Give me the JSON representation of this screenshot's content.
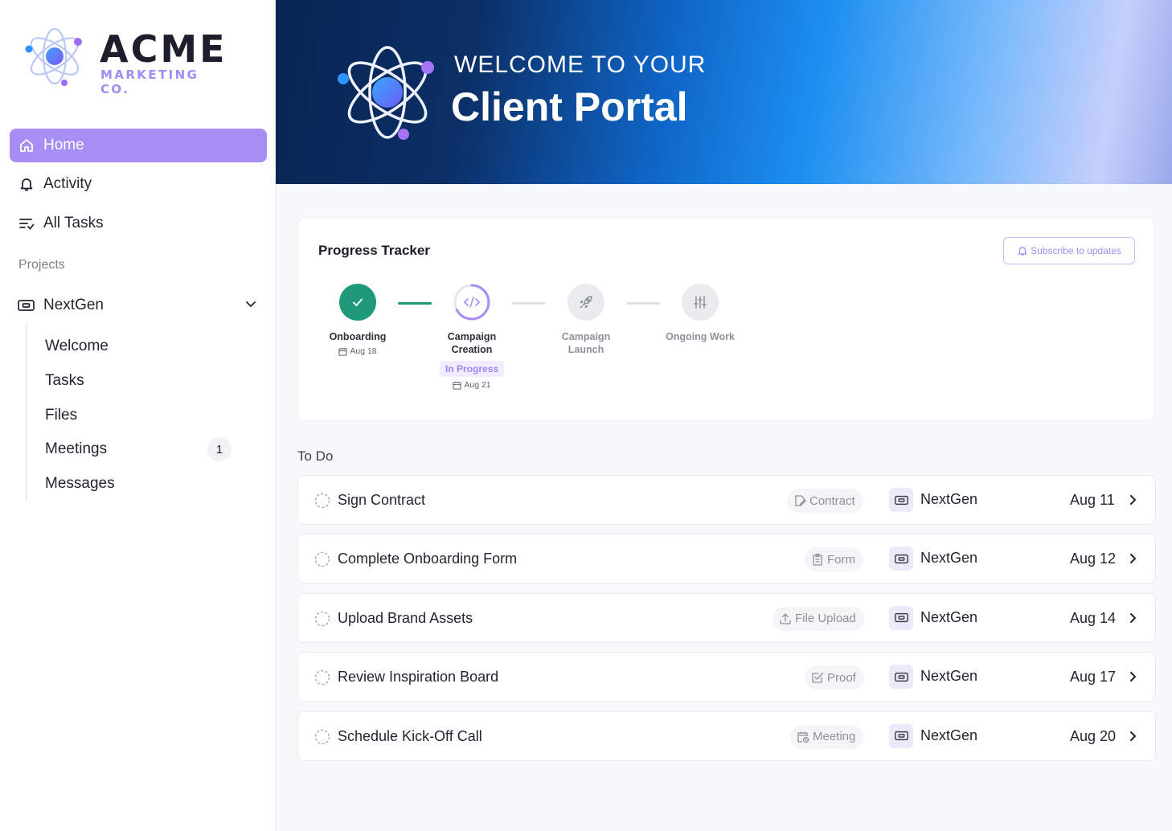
{
  "brand": {
    "name": "ACME",
    "tagline": "MARKETING CO."
  },
  "sidebar": {
    "nav": [
      {
        "label": "Home",
        "icon": "home-icon",
        "active": true
      },
      {
        "label": "Activity",
        "icon": "bell-icon",
        "active": false
      },
      {
        "label": "All Tasks",
        "icon": "list-check-icon",
        "active": false
      }
    ],
    "projects_heading": "Projects",
    "project": {
      "name": "NextGen",
      "icon": "ticket-icon",
      "expanded": true
    },
    "subnav": [
      {
        "label": "Welcome"
      },
      {
        "label": "Tasks"
      },
      {
        "label": "Files"
      },
      {
        "label": "Meetings",
        "badge": "1"
      },
      {
        "label": "Messages"
      }
    ]
  },
  "hero": {
    "kicker": "WELCOME TO YOUR",
    "title": "Client Portal"
  },
  "progress": {
    "title": "Progress Tracker",
    "subscribe_label": "Subscribe to updates",
    "steps": [
      {
        "label_line1": "Onboarding",
        "label_line2": "",
        "status": "done",
        "date": "Aug 18",
        "icon": "check-icon"
      },
      {
        "label_line1": "Campaign",
        "label_line2": "Creation",
        "status": "in-progress",
        "status_label": "In Progress",
        "date": "Aug 21",
        "icon": "code-icon"
      },
      {
        "label_line1": "Campaign",
        "label_line2": "Launch",
        "status": "pending",
        "date": "",
        "icon": "rocket-icon"
      },
      {
        "label_line1": "Ongoing Work",
        "label_line2": "",
        "status": "pending",
        "date": "",
        "icon": "sliders-icon"
      }
    ]
  },
  "todo": {
    "heading": "To Do",
    "items": [
      {
        "title": "Sign Contract",
        "tag": "Contract",
        "tag_icon": "contract-icon",
        "project": "NextGen",
        "due": "Aug 11"
      },
      {
        "title": "Complete Onboarding Form",
        "tag": "Form",
        "tag_icon": "clipboard-icon",
        "project": "NextGen",
        "due": "Aug 12"
      },
      {
        "title": "Upload Brand Assets",
        "tag": "File Upload",
        "tag_icon": "upload-icon",
        "project": "NextGen",
        "due": "Aug 14"
      },
      {
        "title": "Review Inspiration Board",
        "tag": "Proof",
        "tag_icon": "proof-icon",
        "project": "NextGen",
        "due": "Aug 17"
      },
      {
        "title": "Schedule Kick-Off Call",
        "tag": "Meeting",
        "tag_icon": "calendar-clock-icon",
        "project": "NextGen",
        "due": "Aug 20"
      }
    ]
  },
  "colors": {
    "accent": "#a68ef4",
    "done": "#1f9a78",
    "hero_dark": "#082452"
  }
}
